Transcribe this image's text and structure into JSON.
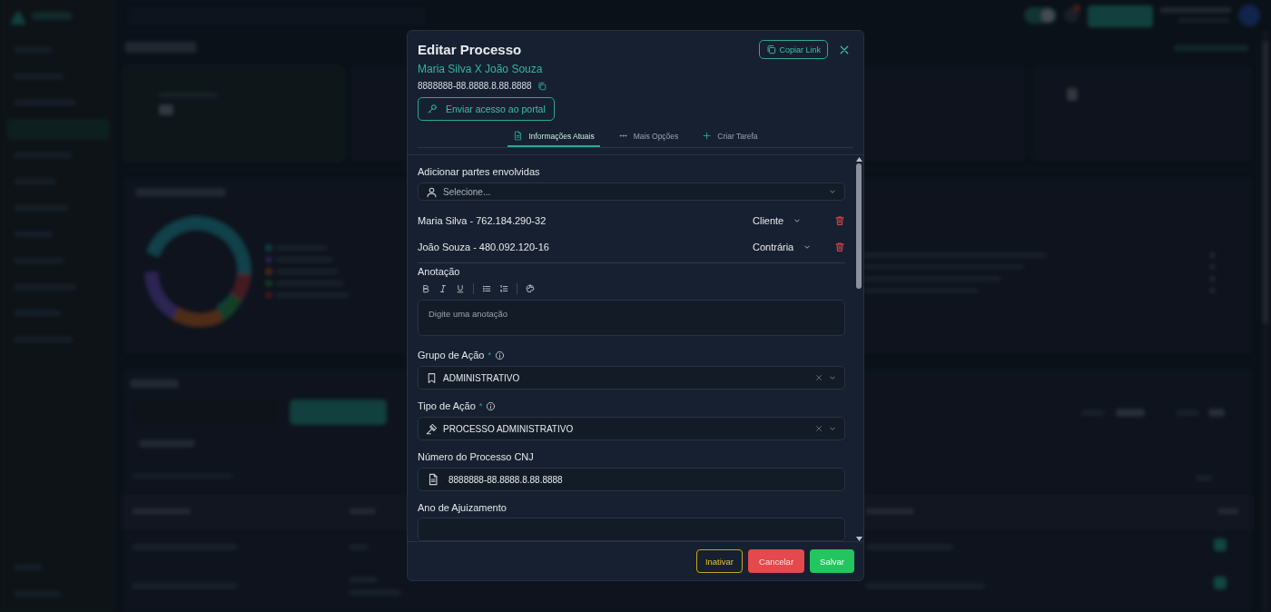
{
  "modal": {
    "title": "Editar Processo",
    "copy_link": "Copiar Link",
    "parties_title": "Maria Silva X João Souza",
    "process_number": "8888888-88.8888.8.88.8888",
    "portal_button": "Enviar acesso ao portal",
    "tabs": [
      {
        "label": "Informações Atuais",
        "selected": true
      },
      {
        "label": "Mais Opções",
        "selected": false
      },
      {
        "label": "Criar Tarefa",
        "selected": false
      }
    ],
    "form": {
      "parties_label": "Adicionar partes envolvidas",
      "parties_select": {
        "placeholder": "Selecione..."
      },
      "parties": [
        {
          "name": "Maria Silva - 762.184.290-32",
          "role": "Cliente"
        },
        {
          "name": "João Souza - 480.092.120-16",
          "role": "Contrária"
        }
      ],
      "annotation": {
        "label": "Anotação",
        "tools": [
          {
            "kind": "bold"
          },
          {
            "kind": "italic"
          },
          {
            "kind": "underline"
          },
          {
            "kind": "divider"
          },
          {
            "kind": "bullet_list"
          },
          {
            "kind": "ordered_list"
          },
          {
            "kind": "divider"
          },
          {
            "kind": "palette"
          }
        ],
        "placeholder": "Digite uma anotação"
      },
      "fields": [
        {
          "kind": "select",
          "label": "Grupo de Ação",
          "required_mark": "*",
          "info": true,
          "value": "ADMINISTRATIVO"
        },
        {
          "kind": "select",
          "label": "Tipo de Ação",
          "required_mark": "*",
          "info": true,
          "value": "PROCESSO ADMINISTRATIVO"
        },
        {
          "kind": "text",
          "label": "Número do Processo CNJ",
          "value": "8888888-88.8888.8.88.8888"
        },
        {
          "kind": "cut",
          "label": "Ano de Ajuizamento"
        }
      ]
    },
    "buttons": [
      {
        "label": "Inativar",
        "kind": "outline"
      },
      {
        "label": "Cancelar",
        "kind": "danger"
      },
      {
        "label": "Salvar",
        "kind": "success"
      }
    ]
  }
}
